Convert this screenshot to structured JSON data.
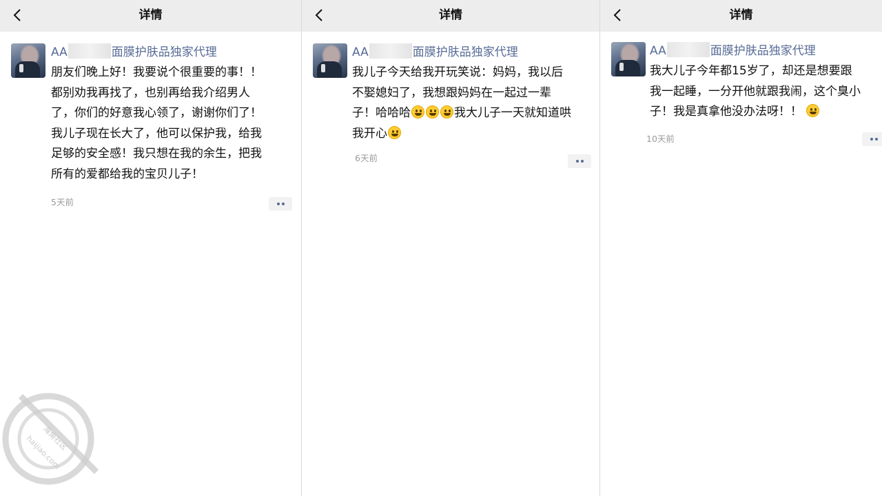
{
  "panels": [
    {
      "title": "详情",
      "name_prefix": "AA",
      "name_suffix": "面膜护肤品独家代理",
      "lines": [
        "朋友们晚上好！我要说个很重要的事！！",
        "都别劝我再找了，也别再给我介绍男人",
        "了，你们的好意我心领了，谢谢你们了！",
        "我儿子现在长大了，他可以保护我，给我",
        "足够的安全感！我只想在我的余生，把我",
        "所有的爱都给我的宝贝儿子！"
      ],
      "time": "5天前"
    },
    {
      "title": "详情",
      "name_prefix": "AA",
      "name_suffix": "面膜护肤品独家代理",
      "lines": [
        "我儿子今天给我开玩笑说：妈妈，我以后",
        "不娶媳妇了，我想跟妈妈在一起过一辈",
        "子！哈哈哈",
        "我大儿子一天就知道哄",
        "我开心"
      ],
      "time": "6天前"
    },
    {
      "title": "详情",
      "name_prefix": "AA",
      "name_suffix": "面膜护肤品独家代理",
      "lines": [
        "我大儿子今年都15岁了，却还是想要跟",
        "我一起睡，一分开他就跟我闹，这个臭小",
        "子！我是真拿他没办法呀！！"
      ],
      "time": "10天前"
    }
  ],
  "icons": {
    "back": "chevron-left-icon",
    "more": "more-dots-icon",
    "emoji": "smile-emoji-icon"
  },
  "watermark": {
    "text_cn": "海角社区",
    "text_url": "haijiao.com"
  },
  "colors": {
    "topbar": "#ededed",
    "name": "#576b95",
    "time": "#9b9b9b",
    "text": "#111111"
  }
}
